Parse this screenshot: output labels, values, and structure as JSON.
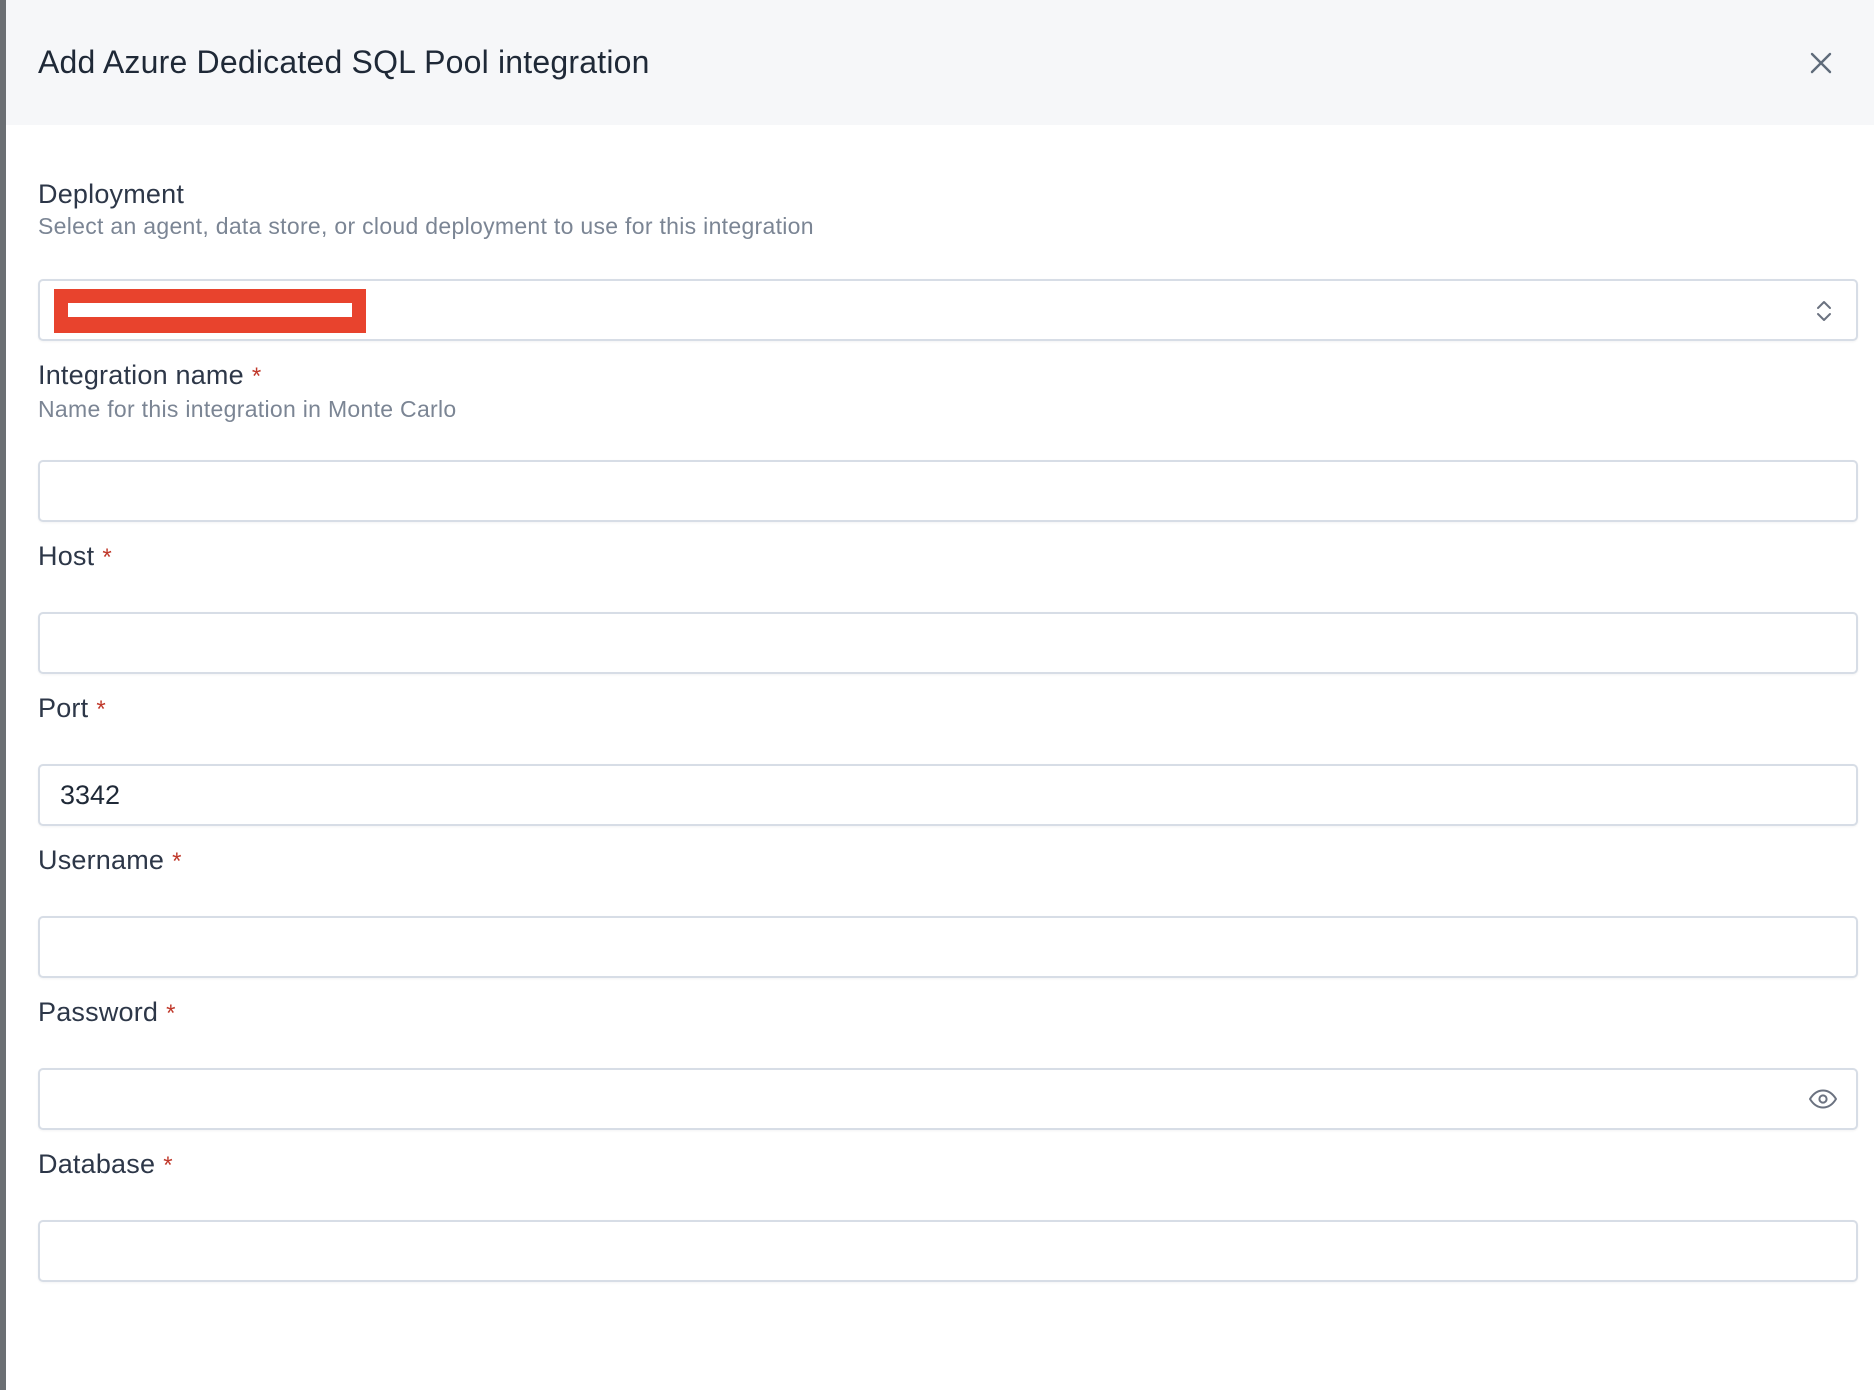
{
  "modal": {
    "title": "Add Azure Dedicated SQL Pool integration",
    "close_icon": "close-icon"
  },
  "form": {
    "deployment": {
      "label": "Deployment",
      "help": "Select an agent, data store, or cloud deployment to use for this integration",
      "selected_value": "[redacted]",
      "icon": "chevron-up-down-icon"
    },
    "integration_name": {
      "label": "Integration name",
      "required_mark": "*",
      "help": "Name for this integration in Monte Carlo",
      "value": ""
    },
    "host": {
      "label": "Host",
      "required_mark": "*",
      "value": ""
    },
    "port": {
      "label": "Port",
      "required_mark": "*",
      "value": "3342"
    },
    "username": {
      "label": "Username",
      "required_mark": "*",
      "value": ""
    },
    "password": {
      "label": "Password",
      "required_mark": "*",
      "value": "",
      "icon": "eye-icon"
    },
    "database": {
      "label": "Database",
      "required_mark": "*",
      "value": ""
    }
  },
  "colors": {
    "header_background": "#f6f7f9",
    "required_mark": "#c0392b",
    "redaction": "#e8432d",
    "input_border": "#d7dde6",
    "help_text": "#7b8594"
  }
}
